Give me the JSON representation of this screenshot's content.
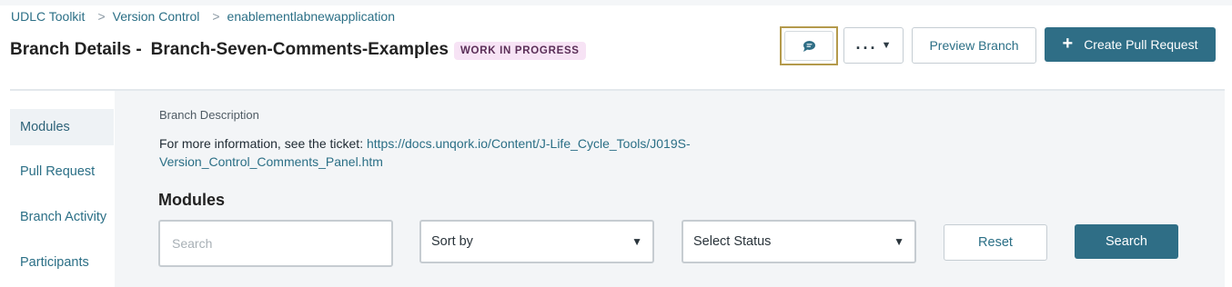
{
  "breadcrumb": {
    "items": [
      "UDLC Toolkit",
      "Version Control",
      "enablementlabnewapplication"
    ],
    "separator": ">"
  },
  "header": {
    "title_prefix": "Branch Details -",
    "branch_name": "Branch-Seven-Comments-Examples",
    "status_badge": "WORK IN PROGRESS"
  },
  "toolbar": {
    "comment_icon": "comment-bubble-icon",
    "more_label": "...",
    "more_caret": "▼",
    "preview_label": "Preview Branch",
    "create_plus": "+",
    "create_label": "Create Pull Request"
  },
  "sidebar": {
    "items": [
      {
        "label": "Modules",
        "active": true
      },
      {
        "label": "Pull Request",
        "active": false
      },
      {
        "label": "Branch Activity",
        "active": false
      },
      {
        "label": "Participants",
        "active": false
      }
    ]
  },
  "main": {
    "description_label": "Branch Description",
    "description_text": "For more information, see the ticket: ",
    "description_link": "https://docs.unqork.io/Content/J-Life_Cycle_Tools/J019S-Version_Control_Comments_Panel.htm",
    "section_title": "Modules",
    "filters": {
      "search_placeholder": "Search",
      "sort_label": "Sort by",
      "status_label": "Select Status",
      "caret": "▼",
      "reset_label": "Reset",
      "search_label": "Search"
    }
  },
  "colors": {
    "accent": "#2f6e86",
    "link": "#2b6f86",
    "badge_bg": "#f7e3f5",
    "focus_border": "#b49a4c"
  }
}
